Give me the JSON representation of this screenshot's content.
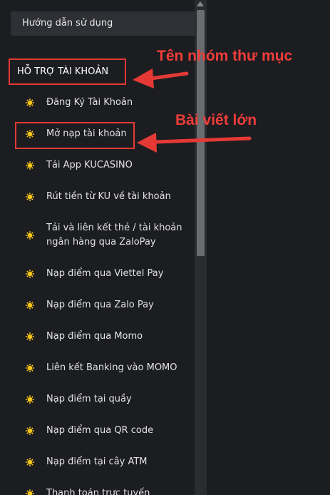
{
  "sidebar": {
    "guide_tab_label": "Hướng dẫn sử dụng",
    "group_title": "HỖ TRỢ TÀI KHOẢN",
    "items": [
      {
        "label": "Đăng Ký Tài Khoản"
      },
      {
        "label": "Mở nạp tài khoản"
      },
      {
        "label": "Tải App KUCASINO"
      },
      {
        "label": "Rút tiền từ KU về tài khoản"
      },
      {
        "label": "Tải và liên kết thẻ / tài khoản",
        "label2": "ngân hàng qua ZaloPay"
      },
      {
        "label": "Nạp điểm qua Viettel Pay"
      },
      {
        "label": "Nạp điểm qua Zalo Pay"
      },
      {
        "label": "Nạp điểm qua Momo"
      },
      {
        "label": "Liên kết Banking vào MOMO"
      },
      {
        "label": "Nạp điểm tại quầy"
      },
      {
        "label": "Nạp điểm qua QR code"
      },
      {
        "label": "Nạp điểm tại cây ATM"
      },
      {
        "label": "Thanh toán trực tuyến"
      }
    ]
  },
  "annotations": {
    "group_label": "Tên nhóm thư mục",
    "article_label": "Bài viết lớn"
  },
  "colors": {
    "background": "#1c1d21",
    "accent_red": "#e53935",
    "bullet_yellow": "#f5c518"
  },
  "icons": {
    "bullet": "sun-icon"
  }
}
